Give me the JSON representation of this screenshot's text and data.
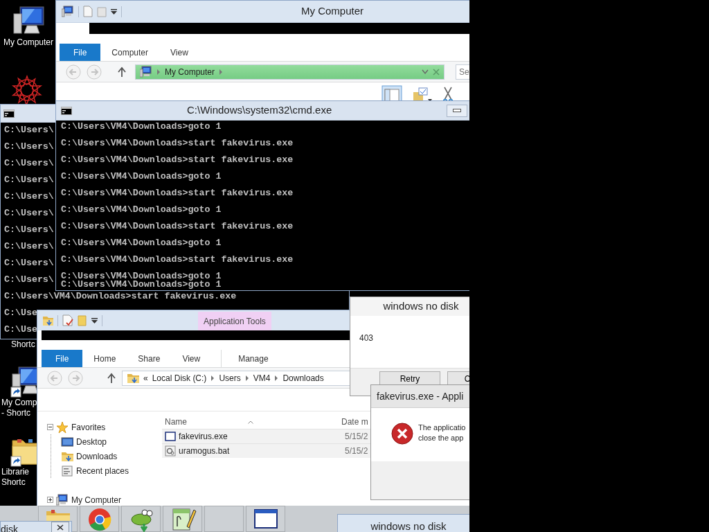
{
  "desktop_icons": [
    {
      "kind": "computer",
      "lines": [
        "My Computer"
      ]
    },
    {
      "kind": "star"
    },
    {
      "kind": "label",
      "lines": [
        "Shortc"
      ]
    },
    {
      "kind": "computer_shortcut",
      "lines": [
        "My Comp",
        "- Shortc"
      ]
    },
    {
      "kind": "libraries_shortcut",
      "lines": [
        "Librarie",
        "Shortc"
      ]
    }
  ],
  "my_computer_window": {
    "title": "My Computer",
    "tabs": [
      {
        "label": "File",
        "kind": "backstage"
      },
      {
        "label": "Computer",
        "kind": "tab"
      },
      {
        "label": "View",
        "kind": "tab"
      }
    ],
    "address": "My Computer",
    "search": {
      "placeholder": "Se"
    }
  },
  "back_console": {
    "blocks": [
      [
        "C:\\Users\\"
      ],
      [
        "C:\\Users\\"
      ],
      [
        "C:\\Users\\"
      ],
      [
        "C:\\Users\\"
      ],
      [
        "C:\\Users\\"
      ],
      [
        "C:\\Users\\"
      ],
      [
        "C:\\Users\\"
      ],
      [
        "C:\\Users\\"
      ],
      [
        "C:\\Users\\"
      ],
      [
        "C:\\Users\\"
      ],
      [
        "C:\\Users\\VM4\\Downloads>start fakevirus.exe"
      ],
      [
        "C:\\Use"
      ],
      [
        "C:\\Use"
      ]
    ]
  },
  "console_window": {
    "title": "C:\\Windows\\system32\\cmd.exe",
    "blocks": [
      [
        "C:\\Users\\VM4\\Downloads>goto 1"
      ],
      [
        "C:\\Users\\VM4\\Downloads>start fakevirus.exe"
      ],
      [
        "C:\\Users\\VM4\\Downloads>start fakevirus.exe"
      ],
      [
        "C:\\Users\\VM4\\Downloads>goto 1"
      ],
      [
        "C:\\Users\\VM4\\Downloads>start fakevirus.exe"
      ],
      [
        "C:\\Users\\VM4\\Downloads>goto 1"
      ],
      [
        "C:\\Users\\VM4\\Downloads>start fakevirus.exe"
      ],
      [
        "C:\\Users\\VM4\\Downloads>goto 1"
      ],
      [
        "C:\\Users\\VM4\\Downloads>start fakevirus.exe"
      ],
      [
        "C:\\Users\\VM4\\Downloads>goto 1",
        "C:\\Users\\VM4\\Downloads>goto 1"
      ]
    ]
  },
  "downloads_window": {
    "context_tab": "Application Tools",
    "tabs": [
      {
        "label": "File",
        "kind": "backstage"
      },
      {
        "label": "Home",
        "kind": "tab"
      },
      {
        "label": "Share",
        "kind": "tab"
      },
      {
        "label": "View",
        "kind": "tab"
      },
      {
        "label": "Manage",
        "kind": "context"
      }
    ],
    "address_overflow": "«",
    "breadcrumb": [
      "Local Disk (C:)",
      "Users",
      "VM4",
      "Downloads"
    ],
    "nav": [
      {
        "label": "Favorites",
        "kind": "favorites",
        "expanded": true,
        "children": [
          {
            "label": "Desktop",
            "kind": "desktop"
          },
          {
            "label": "Downloads",
            "kind": "downloads"
          },
          {
            "label": "Recent places",
            "kind": "recent"
          }
        ]
      },
      {
        "label": "My Computer",
        "kind": "computer",
        "expanded": false
      }
    ],
    "columns": [
      "Name",
      "Date m"
    ],
    "files": [
      {
        "name": "fakevirus.exe",
        "date": "5/15/2",
        "kind": "exe"
      },
      {
        "name": "uramogus.bat",
        "date": "5/15/2",
        "kind": "bat"
      }
    ]
  },
  "no_disk_dialog": {
    "title": "windows no disk",
    "message": "403",
    "buttons": [
      "Retry",
      "C"
    ]
  },
  "app_error_dialog": {
    "title": "fakevirus.exe - Appli",
    "message_lines": [
      "The applicatio",
      "close the app"
    ]
  },
  "taskbar": {
    "buttons": [
      {
        "kind": "folder"
      },
      {
        "kind": "browser"
      },
      {
        "kind": "creature"
      },
      {
        "kind": "notepad"
      },
      {
        "kind": "blank"
      },
      {
        "kind": "window"
      }
    ]
  },
  "disk_window": {
    "title": "disk"
  },
  "no_disk_window": {
    "title": "windows no disk"
  }
}
